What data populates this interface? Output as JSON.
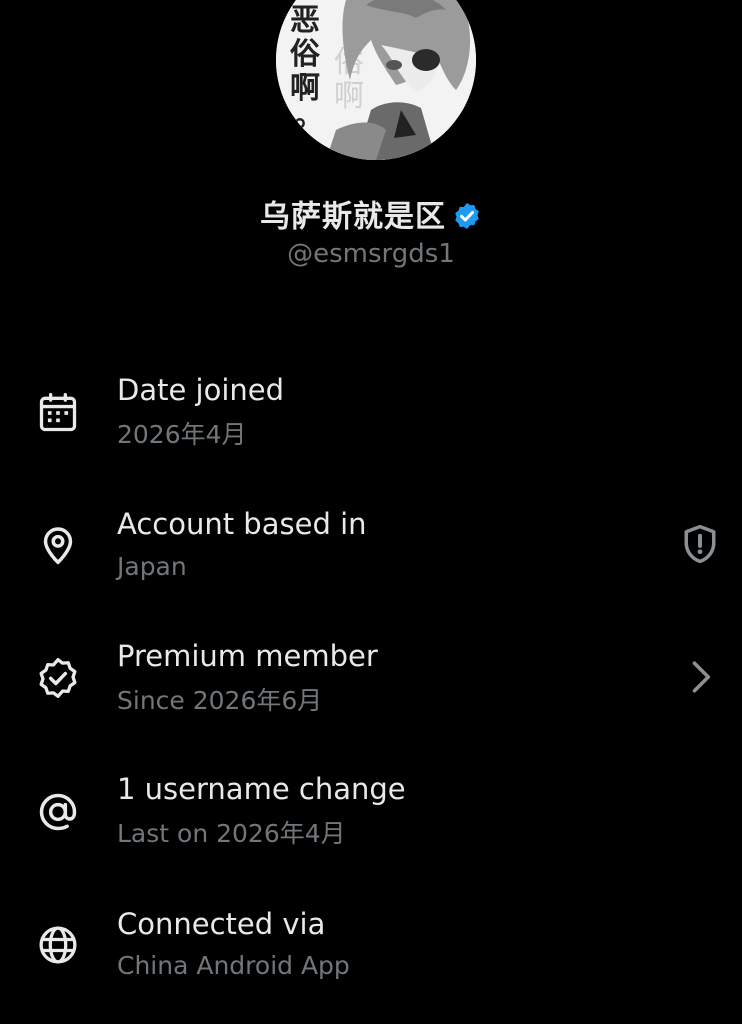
{
  "profile": {
    "display_name": "乌萨斯就是区",
    "handle": "@esmsrgds1",
    "verified_color": "#1d9bf0"
  },
  "avatar": {
    "text_chars": [
      "恶",
      "俗",
      "啊",
      "。"
    ]
  },
  "about_rows": [
    {
      "icon": "calendar-icon",
      "title": "Date joined",
      "subtitle": "2026年4月"
    },
    {
      "icon": "location-pin-icon",
      "title": "Account based in",
      "subtitle": "Japan",
      "right_icon": "shield-alert-icon"
    },
    {
      "icon": "verified-badge-outline-icon",
      "title": "Premium member",
      "subtitle": "Since 2026年6月",
      "right_icon": "chevron-right-icon"
    },
    {
      "icon": "at-sign-icon",
      "title": "1 username change",
      "subtitle": "Last on 2026年4月"
    },
    {
      "icon": "globe-icon",
      "title": "Connected via",
      "subtitle": "China Android App"
    }
  ],
  "colors": {
    "background": "#000000",
    "primary_text": "#e7e9ea",
    "secondary_text": "#71767b",
    "accent": "#1d9bf0"
  }
}
